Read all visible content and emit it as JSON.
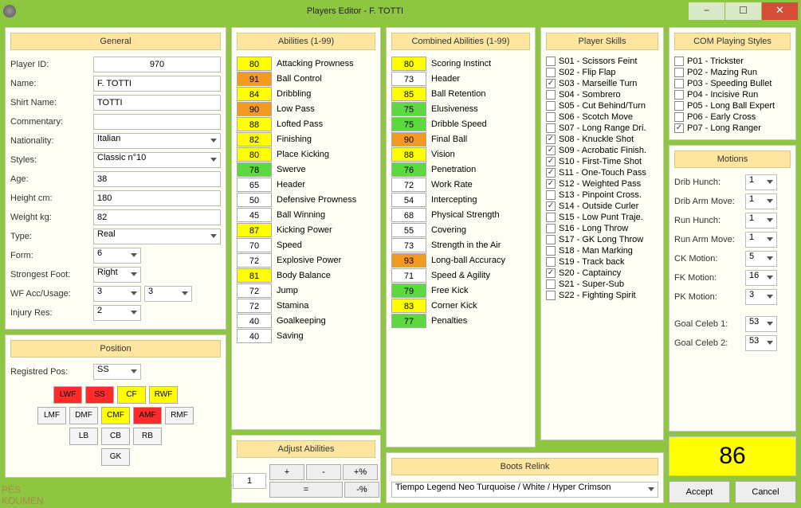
{
  "window": {
    "title": "Players Editor - F. TOTTI"
  },
  "general": {
    "title": "General",
    "playerIdLabel": "Player ID:",
    "playerId": "970",
    "nameLabel": "Name:",
    "name": "F. TOTTI",
    "shirtLabel": "Shirt Name:",
    "shirt": "TOTTI",
    "commentaryLabel": "Commentary:",
    "commentary": "",
    "nationalityLabel": "Nationality:",
    "nationality": "Italian",
    "stylesLabel": "Styles:",
    "styles": "Classic n°10",
    "ageLabel": "Age:",
    "age": "38",
    "heightLabel": "Height cm:",
    "height": "180",
    "weightLabel": "Weight kg:",
    "weight": "82",
    "typeLabel": "Type:",
    "type": "Real",
    "formLabel": "Form:",
    "form": "6",
    "footLabel": "Strongest Foot:",
    "foot": "Right",
    "wfLabel": "WF Acc/Usage:",
    "wfAcc": "3",
    "wfUsage": "3",
    "injuryLabel": "Injury Res:",
    "injury": "2"
  },
  "position": {
    "title": "Position",
    "regLabel": "Registred Pos:",
    "reg": "SS",
    "rows": [
      [
        {
          "l": "LWF",
          "c": "red"
        },
        {
          "l": "SS",
          "c": "red"
        },
        {
          "l": "CF",
          "c": "yellow"
        },
        {
          "l": "RWF",
          "c": "yellow"
        }
      ],
      [
        {
          "l": "LMF",
          "c": ""
        },
        {
          "l": "DMF",
          "c": ""
        },
        {
          "l": "CMF",
          "c": "yellow"
        },
        {
          "l": "AMF",
          "c": "red"
        },
        {
          "l": "RMF",
          "c": ""
        }
      ],
      [
        {
          "l": "LB",
          "c": ""
        },
        {
          "l": "CB",
          "c": ""
        },
        {
          "l": "RB",
          "c": ""
        }
      ],
      [
        {
          "l": "GK",
          "c": ""
        }
      ]
    ]
  },
  "abilities": {
    "title": "Abilities (1-99)",
    "items": [
      {
        "v": "80",
        "l": "Attacking Prowness",
        "c": "yellow"
      },
      {
        "v": "91",
        "l": "Ball Control",
        "c": "orange"
      },
      {
        "v": "84",
        "l": "Dribbling",
        "c": "yellow"
      },
      {
        "v": "90",
        "l": "Low Pass",
        "c": "orange"
      },
      {
        "v": "88",
        "l": "Lofted Pass",
        "c": "yellow"
      },
      {
        "v": "82",
        "l": "Finishing",
        "c": "yellow"
      },
      {
        "v": "80",
        "l": "Place Kicking",
        "c": "yellow"
      },
      {
        "v": "78",
        "l": "Swerve",
        "c": "green"
      },
      {
        "v": "65",
        "l": "Header",
        "c": "white"
      },
      {
        "v": "50",
        "l": "Defensive Prowness",
        "c": "white"
      },
      {
        "v": "45",
        "l": "Ball Winning",
        "c": "white"
      },
      {
        "v": "87",
        "l": "Kicking Power",
        "c": "yellow"
      },
      {
        "v": "70",
        "l": "Speed",
        "c": "white"
      },
      {
        "v": "72",
        "l": "Explosive Power",
        "c": "white"
      },
      {
        "v": "81",
        "l": "Body Balance",
        "c": "yellow"
      },
      {
        "v": "72",
        "l": "Jump",
        "c": "white"
      },
      {
        "v": "72",
        "l": "Stamina",
        "c": "white"
      },
      {
        "v": "40",
        "l": "Goalkeeping",
        "c": "white"
      },
      {
        "v": "40",
        "l": "Saving",
        "c": "white"
      }
    ]
  },
  "combined": {
    "title": "Combined Abilities  (1-99)",
    "items": [
      {
        "v": "80",
        "l": "Scoring Instinct",
        "c": "yellow"
      },
      {
        "v": "73",
        "l": "Header",
        "c": "white"
      },
      {
        "v": "85",
        "l": "Ball Retention",
        "c": "yellow"
      },
      {
        "v": "75",
        "l": "Elusiveness",
        "c": "green"
      },
      {
        "v": "75",
        "l": "Dribble Speed",
        "c": "green"
      },
      {
        "v": "90",
        "l": "Final Ball",
        "c": "orange"
      },
      {
        "v": "88",
        "l": "Vision",
        "c": "yellow"
      },
      {
        "v": "76",
        "l": "Penetration",
        "c": "green"
      },
      {
        "v": "72",
        "l": "Work Rate",
        "c": "white"
      },
      {
        "v": "54",
        "l": "Intercepting",
        "c": "white"
      },
      {
        "v": "68",
        "l": "Physical Strength",
        "c": "white"
      },
      {
        "v": "55",
        "l": "Covering",
        "c": "white"
      },
      {
        "v": "73",
        "l": "Strength in the Air",
        "c": "white"
      },
      {
        "v": "93",
        "l": "Long-ball Accuracy",
        "c": "orange"
      },
      {
        "v": "71",
        "l": "Speed & Agility",
        "c": "white"
      },
      {
        "v": "79",
        "l": "Free Kick",
        "c": "green"
      },
      {
        "v": "83",
        "l": "Corner Kick",
        "c": "yellow"
      },
      {
        "v": "77",
        "l": "Penalties",
        "c": "green"
      }
    ]
  },
  "skills": {
    "title": "Player Skills",
    "items": [
      {
        "l": "S01 - Scissors Feint",
        "on": false
      },
      {
        "l": "S02 - Flip Flap",
        "on": false
      },
      {
        "l": "S03 - Marseille Turn",
        "on": true
      },
      {
        "l": "S04 - Sombrero",
        "on": false
      },
      {
        "l": "S05 - Cut Behind/Turn",
        "on": false
      },
      {
        "l": "S06 - Scotch Move",
        "on": false
      },
      {
        "l": "S07 - Long Range Dri.",
        "on": false
      },
      {
        "l": "S08 - Knuckle Shot",
        "on": true
      },
      {
        "l": "S09 - Acrobatic Finish.",
        "on": true
      },
      {
        "l": "S10 - First-Time Shot",
        "on": true
      },
      {
        "l": "S11 - One-Touch Pass",
        "on": true
      },
      {
        "l": "S12 - Weighted Pass",
        "on": true
      },
      {
        "l": "S13 - Pinpoint Cross.",
        "on": false
      },
      {
        "l": "S14 - Outside Curler",
        "on": true
      },
      {
        "l": "S15 - Low Punt Traje.",
        "on": false
      },
      {
        "l": "S16 - Long Throw",
        "on": false
      },
      {
        "l": "S17 - GK Long Throw",
        "on": false
      },
      {
        "l": "S18 - Man Marking",
        "on": false
      },
      {
        "l": "S19 - Track back",
        "on": false
      },
      {
        "l": "S20 - Captaincy",
        "on": true
      },
      {
        "l": "S21 - Super-Sub",
        "on": false
      },
      {
        "l": "S22 - Fighting Spirit",
        "on": false
      }
    ]
  },
  "com": {
    "title": "COM Playing Styles",
    "items": [
      {
        "l": "P01 - Trickster",
        "on": false
      },
      {
        "l": "P02 - Mazing Run",
        "on": false
      },
      {
        "l": "P03 - Speeding Bullet",
        "on": false
      },
      {
        "l": "P04 - Incisive Run",
        "on": false
      },
      {
        "l": "P05 - Long Ball Expert",
        "on": false
      },
      {
        "l": "P06 - Early Cross",
        "on": false
      },
      {
        "l": "P07 - Long Ranger",
        "on": true
      }
    ]
  },
  "motions": {
    "title": "Motions",
    "fields": [
      {
        "l": "Drib Hunch:",
        "v": "1"
      },
      {
        "l": "Drib Arm Move:",
        "v": "1"
      },
      {
        "l": "Run Hunch:",
        "v": "1"
      },
      {
        "l": "Run Arm Move:",
        "v": "1"
      },
      {
        "l": "CK Motion:",
        "v": "5"
      },
      {
        "l": "FK Motion:",
        "v": "16"
      },
      {
        "l": "PK Motion:",
        "v": "3"
      }
    ],
    "celeb1Label": "Goal Celeb 1:",
    "celeb1": "53",
    "celeb2Label": "Goal Celeb 2:",
    "celeb2": "53"
  },
  "adjust": {
    "title": "Adjust Abilities",
    "val": "1",
    "plus": "+",
    "minus": "-",
    "plusP": "+%",
    "eq": "=",
    "minusP": "-%"
  },
  "boots": {
    "title": "Boots Relink",
    "value": "Tiempo Legend Neo Turquoise / White / Hyper Crimson"
  },
  "overall": "86",
  "accept": "Accept",
  "cancel": "Cancel"
}
